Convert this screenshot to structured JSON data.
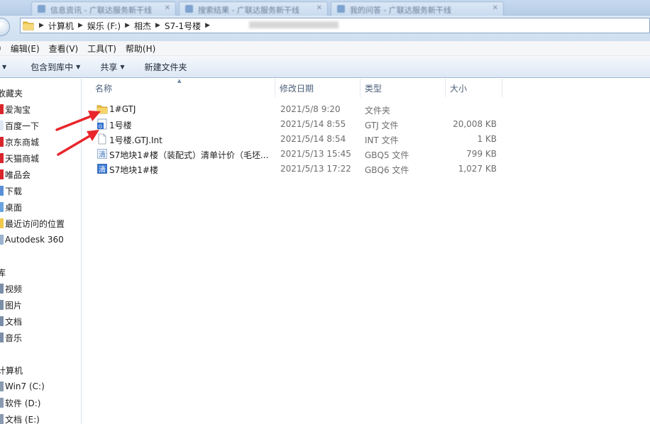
{
  "tabs": [
    {
      "title": "信息资讯 - 广联达服务新干线"
    },
    {
      "title": "搜索结果 - 广联达服务新干线"
    },
    {
      "title": "我的问答 - 广联达服务新干线"
    }
  ],
  "address": {
    "crumbs": [
      "计算机",
      "娱乐 (F:)",
      "相杰",
      "S7-1号楼"
    ]
  },
  "menu": {
    "items": [
      ")",
      "编辑(E)",
      "查看(V)",
      "工具(T)",
      "帮助(H)"
    ]
  },
  "toolbar": {
    "include_library": "包含到库中",
    "share": "共享",
    "new_folder": "新建文件夹"
  },
  "nav": {
    "favorites_header": "收藏夹",
    "favorites": [
      "爱淘宝",
      "百度一下",
      "京东商城",
      "天猫商城",
      "唯品会",
      "下载",
      "桌面",
      "最近访问的位置",
      "Autodesk 360"
    ],
    "library_header": "库",
    "libraries": [
      "视频",
      "图片",
      "文档",
      "音乐"
    ],
    "computer_header": "计算机",
    "drives": [
      "Win7 (C:)",
      "软件 (D:)",
      "文档 (E:)"
    ]
  },
  "columns": {
    "name": "名称",
    "modified": "修改日期",
    "type": "类型",
    "size": "大小"
  },
  "files": [
    {
      "name": "1#GTJ",
      "modified": "2021/5/8 9:20",
      "type": "文件夹",
      "size": "",
      "icon": "folder-icon"
    },
    {
      "name": "1号楼",
      "modified": "2021/5/14 8:55",
      "type": "GTJ 文件",
      "size": "20,008 KB",
      "icon": "gtj-file-icon"
    },
    {
      "name": "1号楼.GTJ.Int",
      "modified": "2021/5/14 8:54",
      "type": "INT 文件",
      "size": "1 KB",
      "icon": "blank-file-icon"
    },
    {
      "name": "S7地块1#楼（装配式）清单计价（毛坯...",
      "modified": "2021/5/13 15:45",
      "type": "GBQ5 文件",
      "size": "799 KB",
      "icon": "gbq5-file-icon"
    },
    {
      "name": "S7地块1#楼",
      "modified": "2021/5/13 17:22",
      "type": "GBQ6 文件",
      "size": "1,027 KB",
      "icon": "gbq6-file-icon"
    }
  ],
  "colors": {
    "annotation_arrow": "#e8262b",
    "folder_yellow": "#f2c94c",
    "window_frame": "#c6d9ee"
  }
}
